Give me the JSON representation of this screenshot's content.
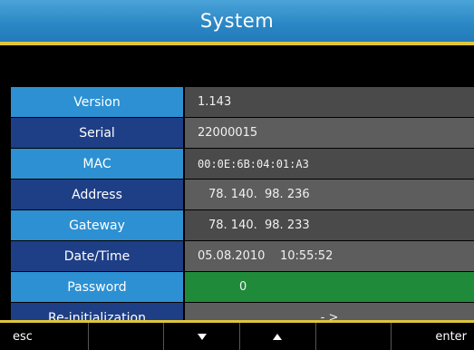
{
  "title": "System",
  "rows": [
    {
      "label": "Version",
      "value": "1.143"
    },
    {
      "label": "Serial",
      "value": "22000015"
    },
    {
      "label": "MAC",
      "value": "00:0E:6B:04:01:A3"
    },
    {
      "label": "Address",
      "value": "78. 140.  98. 236"
    },
    {
      "label": "Gateway",
      "value": "78. 140.  98. 233"
    },
    {
      "label": "Date/Time",
      "value": "05.08.2010    10:55:52"
    },
    {
      "label": "Password",
      "value": "0"
    },
    {
      "label": "Re-initialization",
      "value": "- >"
    }
  ],
  "softkeys": {
    "esc": "esc",
    "enter": "enter",
    "down_icon": "triangle-down",
    "up_icon": "triangle-up"
  },
  "colors": {
    "title_bar": "#2a86c4",
    "accent_rule": "#e0c53a",
    "label_light": "#2c90d3",
    "label_dark": "#1e3f86",
    "password_field": "#1f8a3a"
  }
}
